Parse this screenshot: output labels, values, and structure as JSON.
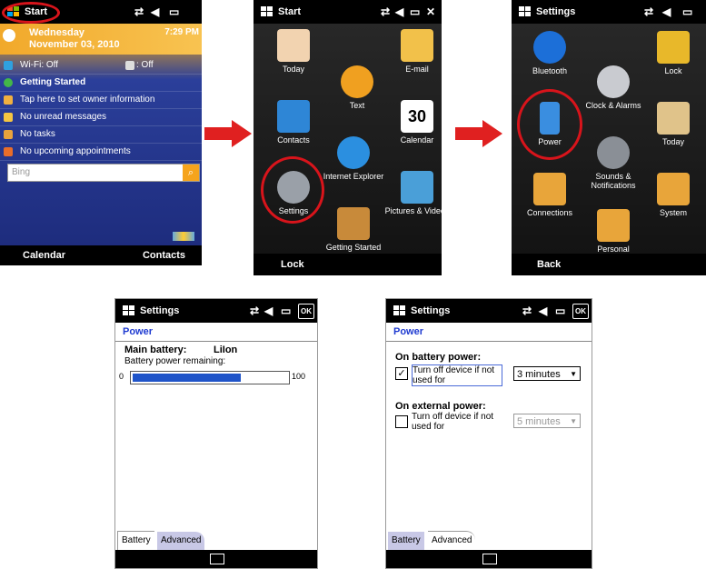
{
  "panel1": {
    "title": "Start",
    "time": "7:29 PM",
    "date_day": "Wednesday",
    "date_full": "November 03, 2010",
    "wifi": "Wi-Fi: Off",
    "bt": ": Off",
    "getting_started": "Getting Started",
    "owner": "Tap here to set owner information",
    "messages": "No unread messages",
    "tasks": "No tasks",
    "appointments": "No upcoming appointments",
    "search_placeholder": "Bing",
    "soft_left": "Calendar",
    "soft_right": "Contacts"
  },
  "panel2": {
    "title": "Start",
    "tiles": [
      "Today",
      "E-mail",
      "Text",
      "Contacts",
      "Calendar",
      "Internet Explorer",
      "Settings",
      "Pictures & Videos",
      "Getting Started"
    ],
    "soft_left": "Lock"
  },
  "panel3": {
    "title": "Settings",
    "tiles": [
      "Bluetooth",
      "Lock",
      "Clock & Alarms",
      "Power",
      "Today",
      "Sounds & Notifications",
      "Connections",
      "System",
      "Personal"
    ],
    "soft_left": "Back"
  },
  "panel4": {
    "title": "Settings",
    "ok": "OK",
    "section": "Power",
    "main_battery_label": "Main battery:",
    "main_battery_value": "LiIon",
    "remaining_label": "Battery power remaining:",
    "min": "0",
    "max": "100",
    "remaining_fraction": 0.7,
    "tabs": [
      "Battery",
      "Advanced"
    ]
  },
  "panel5": {
    "title": "Settings",
    "ok": "OK",
    "section": "Power",
    "battery_header": "On battery power:",
    "battery_check_label": "Turn off device if not used for",
    "battery_value": "3 minutes",
    "external_header": "On external power:",
    "external_check_label": "Turn off device if not used for",
    "external_value": "5 minutes",
    "tabs": [
      "Battery",
      "Advanced"
    ]
  },
  "colors": {
    "highlight": "#d8141b",
    "accent": "#1f3bd1",
    "arrow": "#e02020"
  }
}
